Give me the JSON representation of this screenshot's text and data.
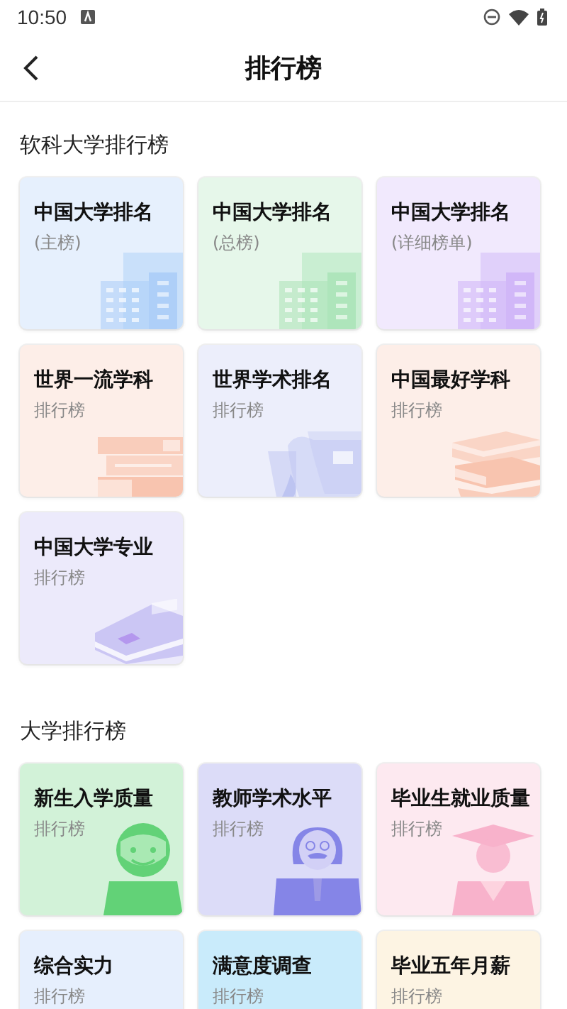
{
  "status_bar": {
    "time": "10:50"
  },
  "header": {
    "title": "排行榜"
  },
  "sections": [
    {
      "title": "软科大学排行榜",
      "cards": [
        {
          "title": "中国大学排名",
          "subtitle": "(主榜)",
          "color": "#e6f0fd",
          "kind": "building"
        },
        {
          "title": "中国大学排名",
          "subtitle": "(总榜)",
          "color": "#e6f7ea",
          "kind": "building"
        },
        {
          "title": "中国大学排名",
          "subtitle": "(详细榜单)",
          "color": "#f1e9fd",
          "kind": "building"
        },
        {
          "title": "世界一流学科",
          "subtitle": "排行榜",
          "color": "#fdeee8",
          "kind": "books"
        },
        {
          "title": "世界学术排名",
          "subtitle": "排行榜",
          "color": "#eceefb",
          "kind": "scroll"
        },
        {
          "title": "中国最好学科",
          "subtitle": "排行榜",
          "color": "#fdeee8",
          "kind": "bookstack"
        },
        {
          "title": "中国大学专业",
          "subtitle": "排行榜",
          "color": "#eceafb",
          "kind": "book"
        }
      ]
    },
    {
      "title": "大学排行榜",
      "cards": [
        {
          "title": "新生入学质量",
          "subtitle": "排行榜",
          "color": "#d2f2d8",
          "kind": "student"
        },
        {
          "title": "教师学术水平",
          "subtitle": "排行榜",
          "color": "#dcdcf8",
          "kind": "teacher"
        },
        {
          "title": "毕业生就业质量",
          "subtitle": "排行榜",
          "color": "#fde9f0",
          "kind": "graduate"
        },
        {
          "title": "综合实力",
          "subtitle": "排行榜",
          "color": "#e6effd",
          "kind": "none"
        },
        {
          "title": "满意度调查",
          "subtitle": "排行榜",
          "color": "#c9ebfb",
          "kind": "none"
        },
        {
          "title": "毕业五年月薪",
          "subtitle": "排行榜",
          "color": "#fdf4e3",
          "kind": "none"
        }
      ]
    }
  ]
}
